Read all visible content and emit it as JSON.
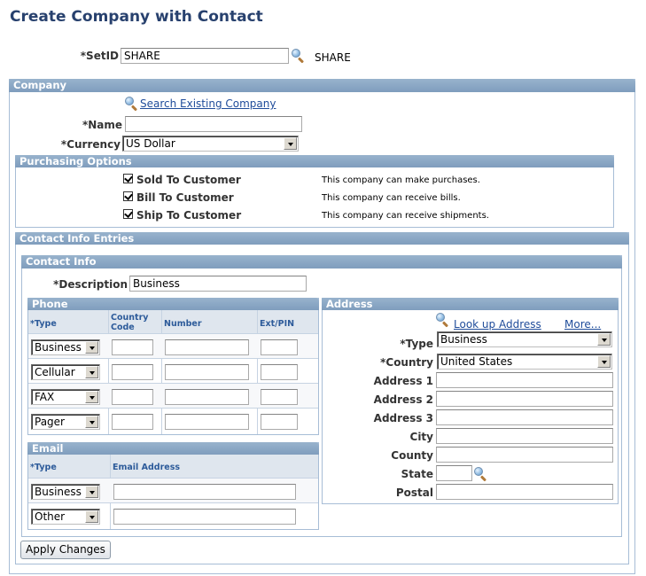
{
  "page": {
    "title": "Create Company with Contact"
  },
  "setid": {
    "label": "*SetID",
    "value": "SHARE",
    "description": "SHARE",
    "lookup_icon": "search-icon"
  },
  "company": {
    "header": "Company",
    "search_link": "Search Existing Company",
    "name_label": "*Name",
    "name_value": "",
    "currency_label": "*Currency",
    "currency_value": "US Dollar",
    "purchasing": {
      "header": "Purchasing Options",
      "options": [
        {
          "label": "Sold To Customer",
          "checked": true,
          "description": "This company can make purchases."
        },
        {
          "label": "Bill To Customer",
          "checked": true,
          "description": "This company can receive bills."
        },
        {
          "label": "Ship To Customer",
          "checked": true,
          "description": "This company can receive shipments."
        }
      ]
    }
  },
  "contact_entries": {
    "header": "Contact Info Entries",
    "contact_info": {
      "header": "Contact Info",
      "description_label": "*Description",
      "description_value": "Business",
      "phone": {
        "header": "Phone",
        "columns": [
          "*Type",
          "Country Code",
          "Number",
          "Ext/PIN"
        ],
        "rows": [
          {
            "type": "Business",
            "country_code": "",
            "number": "",
            "ext": ""
          },
          {
            "type": "Cellular",
            "country_code": "",
            "number": "",
            "ext": ""
          },
          {
            "type": "FAX",
            "country_code": "",
            "number": "",
            "ext": ""
          },
          {
            "type": "Pager",
            "country_code": "",
            "number": "",
            "ext": ""
          }
        ]
      },
      "email": {
        "header": "Email",
        "columns": [
          "*Type",
          "Email Address"
        ],
        "rows": [
          {
            "type": "Business",
            "address": ""
          },
          {
            "type": "Other",
            "address": ""
          }
        ]
      },
      "address": {
        "header": "Address",
        "lookup_link": "Look up Address",
        "more_link": "More...",
        "type_label": "*Type",
        "type_value": "Business",
        "country_label": "*Country",
        "country_value": "United States",
        "fields": [
          {
            "label": "Address 1",
            "value": ""
          },
          {
            "label": "Address 2",
            "value": ""
          },
          {
            "label": "Address 3",
            "value": ""
          },
          {
            "label": "City",
            "value": ""
          },
          {
            "label": "County",
            "value": ""
          }
        ],
        "state_label": "State",
        "state_value": "",
        "postal_label": "Postal",
        "postal_value": ""
      }
    },
    "apply_button": "Apply Changes"
  }
}
